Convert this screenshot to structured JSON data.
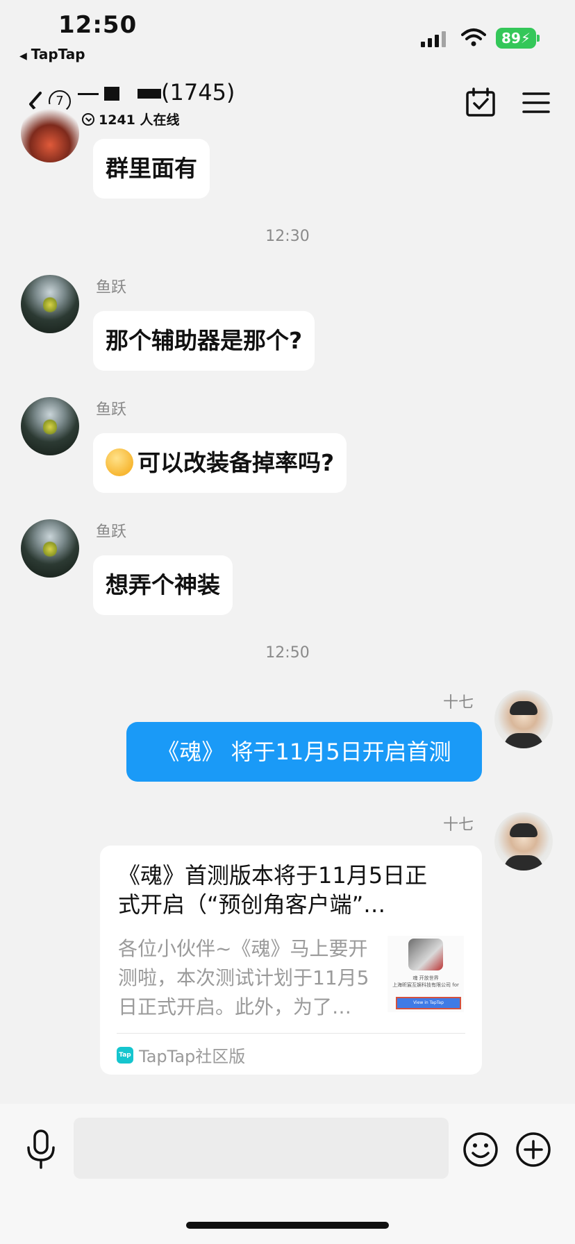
{
  "status_bar": {
    "time": "12:50",
    "back_app": "TapTap",
    "battery": "89"
  },
  "header": {
    "member_badge": "7",
    "title_suffix": "(1745)",
    "online": "1241 人在线"
  },
  "chat": {
    "top_message": "群里面有",
    "time_1": "12:30",
    "sender_a": "鱼跃",
    "msg_1": "那个辅助器是那个?",
    "msg_2": "可以改装备掉率吗?",
    "msg_3": "想弄个神装",
    "time_2": "12:50",
    "sender_b": "十七",
    "msg_4": "《魂》 将于11月5日开启首测",
    "card": {
      "title_line1": "《魂》首测版本将于11月5日正",
      "title_line2": "式开启（“预创角客户端”…",
      "desc_line1": "各位小伙伴~《魂》马上要开",
      "desc_line2": "测啦，本次测试计划于11月5",
      "desc_line3": "日正式开启。此外，为了…",
      "thumb_text1": "魂 开放世界",
      "thumb_text2": "上海昕宸互娱科技有限公司 for",
      "thumb_button": "View in TapTap",
      "source": "TapTap社区版",
      "source_icon": "Tap"
    }
  },
  "input": {
    "placeholder": ""
  },
  "colors": {
    "accent_blue": "#1a9af7",
    "battery_green": "#34c759"
  },
  "icons": [
    "back-chevron-icon",
    "calendar-check-icon",
    "menu-icon",
    "microphone-icon",
    "smiley-icon",
    "plus-circle-icon",
    "signal-icon",
    "wifi-icon"
  ]
}
